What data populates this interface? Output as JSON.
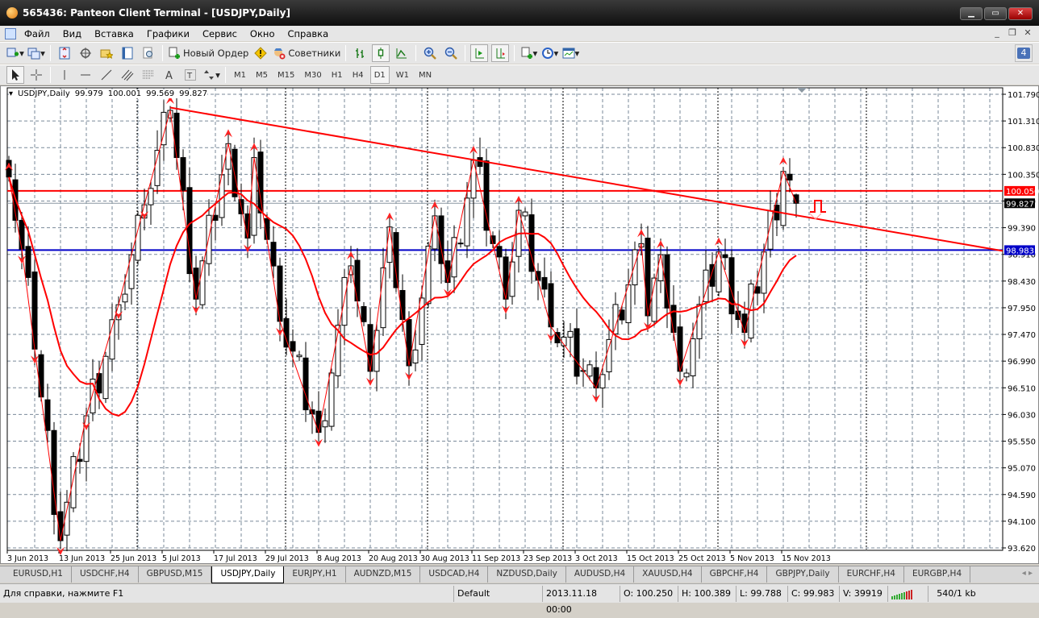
{
  "window": {
    "title": "565436: Panteon Client Terminal - [USDJPY,Daily]",
    "minimize": "▁",
    "maximize": "▭",
    "close": "✕"
  },
  "menu": [
    "Файл",
    "Вид",
    "Вставка",
    "Графики",
    "Сервис",
    "Окно",
    "Справка"
  ],
  "mdi": {
    "minimize": "_",
    "restore": "❐",
    "close": "✕"
  },
  "toolbar": {
    "new_order": "Новый Ордер",
    "experts": "Советники",
    "notifications": "4"
  },
  "timeframes": [
    "M1",
    "M5",
    "M15",
    "M30",
    "H1",
    "H4",
    "D1",
    "W1",
    "MN"
  ],
  "active_timeframe": "D1",
  "chart": {
    "symbol": "USDJPY,Daily",
    "open": "99.979",
    "high": "100.001",
    "low": "99.569",
    "close": "99.827",
    "resistance_label": "100.050",
    "bid_label": "99.827",
    "support_label": "98.983"
  },
  "colors": {
    "up": "#ffffff",
    "down": "#000000",
    "ma": "#ff0000",
    "zigzag": "#ff0000",
    "resistance": "#ff0000",
    "support": "#0000c8",
    "grid": "#7a8a9a"
  },
  "chart_data": {
    "type": "candlestick",
    "title": "USDJPY,Daily",
    "ylim": [
      93.62,
      101.79
    ],
    "y_ticks": [
      "101.790",
      "101.310",
      "100.830",
      "100.350",
      "99.870",
      "99.390",
      "98.910",
      "98.430",
      "97.950",
      "97.470",
      "96.990",
      "96.510",
      "96.030",
      "95.550",
      "95.070",
      "94.590",
      "94.100",
      "93.620"
    ],
    "x_ticks": [
      "3 Jun 2013",
      "13 Jun 2013",
      "25 Jun 2013",
      "5 Jul 2013",
      "17 Jul 2013",
      "29 Jul 2013",
      "8 Aug 2013",
      "20 Aug 2013",
      "30 Aug 2013",
      "11 Sep 2013",
      "23 Sep 2013",
      "3 Oct 2013",
      "15 Oct 2013",
      "25 Oct 2013",
      "5 Nov 2013",
      "15 Nov 2013"
    ],
    "bar_count": 123,
    "zigzag_pivots": [
      [
        0,
        100.3
      ],
      [
        2,
        99.0
      ],
      [
        4,
        97.2
      ],
      [
        8,
        93.75
      ],
      [
        12,
        96.0
      ],
      [
        17,
        98.0
      ],
      [
        21,
        99.8
      ],
      [
        25,
        101.5
      ],
      [
        29,
        98.1
      ],
      [
        34,
        100.9
      ],
      [
        37,
        99.2
      ],
      [
        38,
        100.65
      ],
      [
        42,
        97.7
      ],
      [
        48,
        95.7
      ],
      [
        53,
        98.7
      ],
      [
        56,
        96.8
      ],
      [
        59,
        99.4
      ],
      [
        62,
        96.9
      ],
      [
        66,
        99.6
      ],
      [
        68,
        98.4
      ],
      [
        72,
        100.6
      ],
      [
        77,
        98.1
      ],
      [
        79,
        99.7
      ],
      [
        84,
        97.6
      ],
      [
        91,
        96.5
      ],
      [
        98,
        99.1
      ],
      [
        99,
        97.8
      ],
      [
        101,
        98.9
      ],
      [
        104,
        96.8
      ],
      [
        110,
        98.95
      ],
      [
        114,
        97.5
      ],
      [
        120,
        100.4
      ],
      [
        122,
        99.83
      ]
    ],
    "last_bar": {
      "open": 99.979,
      "high": 100.001,
      "low": 99.569,
      "close": 99.827
    },
    "horizontal_lines": [
      100.05,
      98.983
    ],
    "trendline": {
      "from": [
        25,
        101.55
      ],
      "to": [
        154,
        98.97
      ]
    },
    "ma_period": 14
  },
  "tabs": [
    "EURUSD,H1",
    "USDCHF,H4",
    "GBPUSD,M15",
    "USDJPY,Daily",
    "EURJPY,H1",
    "AUDNZD,M15",
    "USDCAD,H4",
    "NZDUSD,Daily",
    "AUDUSD,H4",
    "XAUUSD,H4",
    "GBPCHF,H4",
    "GBPJPY,Daily",
    "EURCHF,H4",
    "EURGBP,H4"
  ],
  "active_tab": "USDJPY,Daily",
  "tab_nav": "◂ ▸",
  "status": {
    "help": "Для справки, нажмите F1",
    "profile": "Default",
    "datetime": "2013.11.18 00:00",
    "open": "O: 100.250",
    "high": "H: 100.389",
    "low": "L: 99.788",
    "close": "C: 99.983",
    "volume": "V: 39919",
    "traffic": "540/1 kb"
  }
}
